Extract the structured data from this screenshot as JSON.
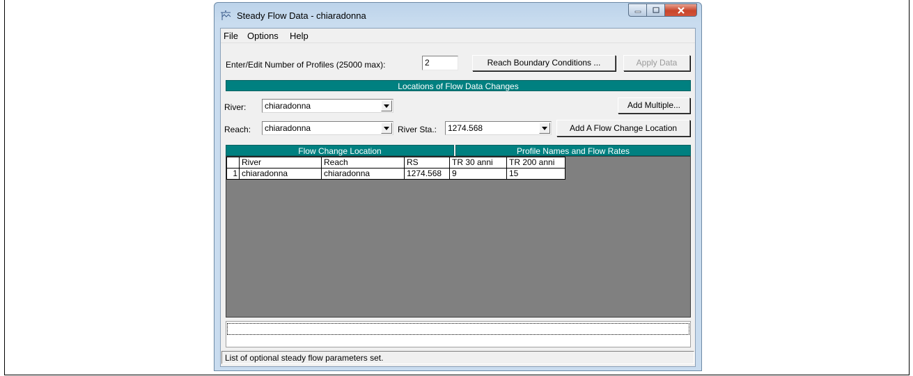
{
  "window": {
    "title": "Steady Flow Data - chiaradonna",
    "icon": "hec-ras-flow-icon"
  },
  "menu": {
    "items": [
      "File",
      "Options",
      "Help"
    ]
  },
  "profiles": {
    "label": "Enter/Edit Number of Profiles (25000 max):",
    "value": "2"
  },
  "toolbar": {
    "reach_boundary_label": "Reach Boundary Conditions ...",
    "apply_data_label": "Apply Data"
  },
  "locations": {
    "header": "Locations of Flow Data Changes",
    "river_label": "River:",
    "river_value": "chiaradonna",
    "reach_label": "Reach:",
    "reach_value": "chiaradonna",
    "river_sta_label": "River Sta.:",
    "river_sta_value": "1274.568",
    "add_multiple_label": "Add Multiple...",
    "add_location_label": "Add A Flow Change Location"
  },
  "grid": {
    "left_header": "Flow Change Location",
    "right_header": "Profile Names and Flow Rates",
    "columns": [
      "River",
      "Reach",
      "RS",
      "TR 30 anni",
      "TR 200 anni"
    ],
    "rows": [
      {
        "num": "1",
        "river": "chiaradonna",
        "reach": "chiaradonna",
        "rs": "1274.568",
        "tr30": "9",
        "tr200": "15"
      }
    ]
  },
  "status": {
    "text": "List of optional steady flow parameters set."
  },
  "colors": {
    "header_teal": "#008080",
    "grid_background": "#808080",
    "close_button": "#c8452b"
  }
}
